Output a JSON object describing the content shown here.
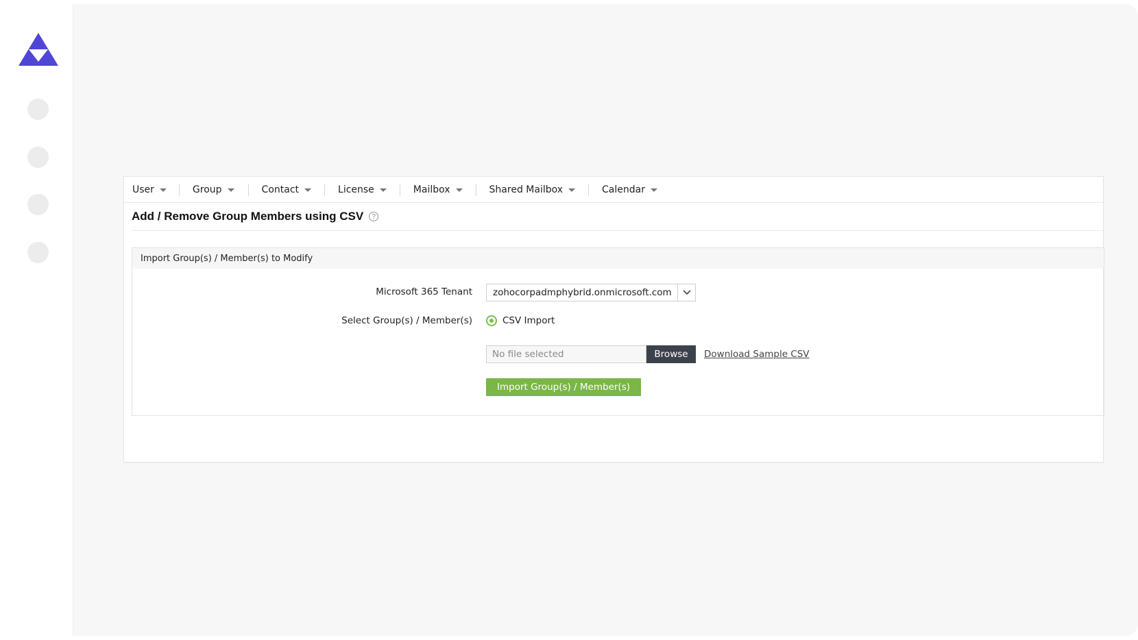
{
  "colors": {
    "brand": "#5046d6",
    "accent_green": "#7ab648",
    "browse_dark": "#3b424b"
  },
  "sidebar": {
    "logo_icon": "triangle-logo-icon",
    "items": [
      {
        "icon": "nav-placeholder-icon"
      },
      {
        "icon": "nav-placeholder-icon"
      },
      {
        "icon": "nav-placeholder-icon"
      },
      {
        "icon": "nav-placeholder-icon"
      }
    ]
  },
  "menubar": {
    "items": [
      {
        "label": "User"
      },
      {
        "label": "Group"
      },
      {
        "label": "Contact"
      },
      {
        "label": "License"
      },
      {
        "label": "Mailbox"
      },
      {
        "label": "Shared Mailbox"
      },
      {
        "label": "Calendar"
      }
    ]
  },
  "page": {
    "title": "Add / Remove Group Members using CSV",
    "help_icon": "?"
  },
  "section": {
    "header": "Import Group(s) / Member(s) to Modify",
    "tenant_label": "Microsoft 365 Tenant",
    "tenant_value": "zohocorpadmphybrid.onmicrosoft.com",
    "select_label": "Select Group(s) / Member(s)",
    "radio_label": "CSV Import",
    "file_placeholder": "No file selected",
    "browse_label": "Browse",
    "sample_link": "Download Sample CSV",
    "import_button": "Import Group(s) / Member(s)"
  }
}
